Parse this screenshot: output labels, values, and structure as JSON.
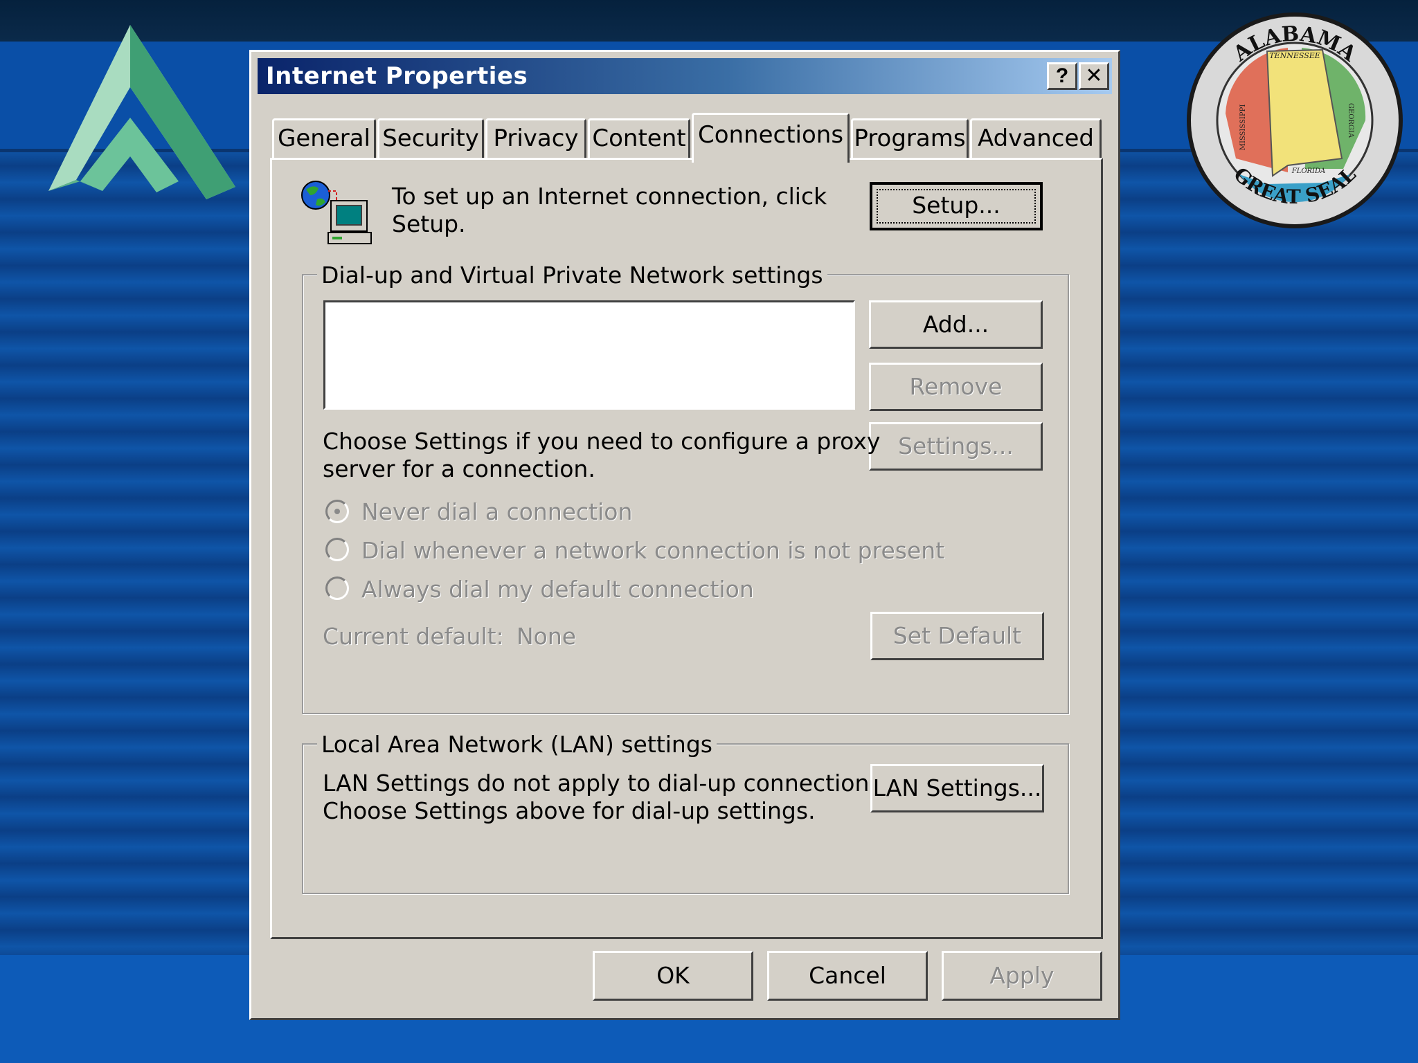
{
  "dialog": {
    "title": "Internet Properties",
    "help_glyph": "?",
    "close_glyph": "✕",
    "tabs": [
      {
        "label": "General"
      },
      {
        "label": "Security"
      },
      {
        "label": "Privacy"
      },
      {
        "label": "Content"
      },
      {
        "label": "Connections"
      },
      {
        "label": "Programs"
      },
      {
        "label": "Advanced"
      }
    ],
    "active_tab": "Connections"
  },
  "setup": {
    "text_line1": "To set up an Internet connection, click",
    "text_line2": "Setup.",
    "button_label": "Setup..."
  },
  "dialup": {
    "group_label": "Dial-up and Virtual Private Network settings",
    "add_label": "Add...",
    "remove_label": "Remove",
    "settings_label": "Settings...",
    "proxy_text_line1": "Choose Settings if you need to configure a proxy",
    "proxy_text_line2": "server for a connection.",
    "radio_options": [
      {
        "label": "Never dial a connection",
        "selected": true
      },
      {
        "label": "Dial whenever a network connection is not present",
        "selected": false
      },
      {
        "label": "Always dial my default connection",
        "selected": false
      }
    ],
    "current_default_label": "Current default:",
    "current_default_value": "None",
    "set_default_label": "Set Default"
  },
  "lan": {
    "group_label": "Local Area Network (LAN) settings",
    "text_line1": "LAN Settings do not apply to dial-up connections.",
    "text_line2": "Choose Settings above for dial-up settings.",
    "button_label": "LAN Settings..."
  },
  "footer": {
    "ok_label": "OK",
    "cancel_label": "Cancel",
    "apply_label": "Apply"
  },
  "seal": {
    "top_text": "ALABAMA",
    "bottom_text": "GREAT SEAL",
    "north": "TENNESSEE",
    "west": "MISSISSIPPI",
    "east": "GEORGIA",
    "south": "FLORIDA"
  },
  "colors": {
    "dialog_face": "#d4d0c8",
    "titlebar_start": "#0a246a",
    "titlebar_end": "#a6caf0",
    "background_blue": "#0a4fa7"
  }
}
